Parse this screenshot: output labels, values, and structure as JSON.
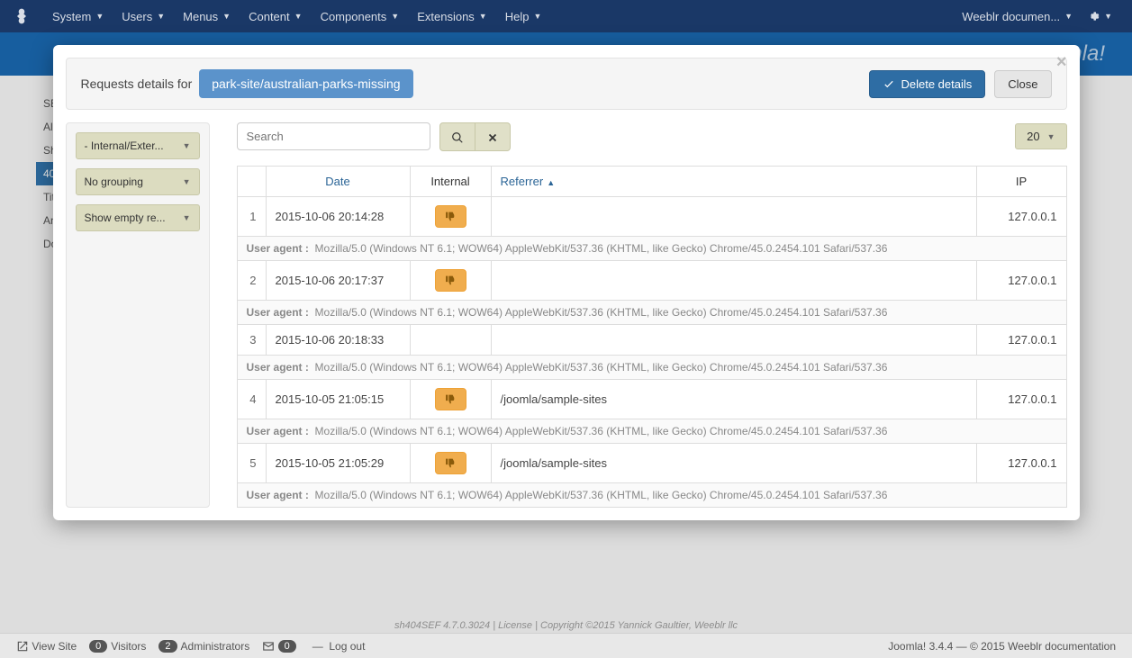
{
  "navbar": {
    "items": [
      "System",
      "Users",
      "Menus",
      "Content",
      "Components",
      "Extensions",
      "Help"
    ],
    "right_label": "Weeblr documen..."
  },
  "brand": "Joomla!",
  "modal": {
    "title_prefix": "Requests details for",
    "url_badge": "park-site/australian-parks-missing",
    "delete_btn": "Delete details",
    "close_btn": "Close",
    "search_placeholder": "Search",
    "page_size": "20"
  },
  "filters": {
    "f1": "- Internal/Exter...",
    "f2": "No grouping",
    "f3": "Show empty re..."
  },
  "columns": {
    "date": "Date",
    "internal": "Internal",
    "referrer": "Referrer",
    "ip": "IP"
  },
  "ua_label": "User agent :",
  "rows": [
    {
      "idx": "1",
      "date": "2015-10-06 20:14:28",
      "thumbs": true,
      "referrer": "",
      "ip": "127.0.0.1",
      "ua": "Mozilla/5.0 (Windows NT 6.1; WOW64) AppleWebKit/537.36 (KHTML, like Gecko) Chrome/45.0.2454.101 Safari/537.36"
    },
    {
      "idx": "2",
      "date": "2015-10-06 20:17:37",
      "thumbs": true,
      "referrer": "",
      "ip": "127.0.0.1",
      "ua": "Mozilla/5.0 (Windows NT 6.1; WOW64) AppleWebKit/537.36 (KHTML, like Gecko) Chrome/45.0.2454.101 Safari/537.36"
    },
    {
      "idx": "3",
      "date": "2015-10-06 20:18:33",
      "thumbs": false,
      "referrer": "",
      "ip": "127.0.0.1",
      "ua": "Mozilla/5.0 (Windows NT 6.1; WOW64) AppleWebKit/537.36 (KHTML, like Gecko) Chrome/45.0.2454.101 Safari/537.36"
    },
    {
      "idx": "4",
      "date": "2015-10-05 21:05:15",
      "thumbs": true,
      "referrer": "/joomla/sample-sites",
      "ip": "127.0.0.1",
      "ua": "Mozilla/5.0 (Windows NT 6.1; WOW64) AppleWebKit/537.36 (KHTML, like Gecko) Chrome/45.0.2454.101 Safari/537.36"
    },
    {
      "idx": "5",
      "date": "2015-10-05 21:05:29",
      "thumbs": true,
      "referrer": "/joomla/sample-sites",
      "ip": "127.0.0.1",
      "ua": "Mozilla/5.0 (Windows NT 6.1; WOW64) AppleWebKit/537.36 (KHTML, like Gecko) Chrome/45.0.2454.101 Safari/537.36"
    }
  ],
  "backdrop_tabs": [
    "SE",
    "Ali",
    "Sh",
    "40",
    "Tit",
    "An",
    "Do"
  ],
  "backdrop_active_tab": "40",
  "footer_line": "sh404SEF 4.7.0.3024 | License | Copyright ©2015 Yannick Gaultier, Weeblr llc",
  "status": {
    "view_site": "View Site",
    "visitors_count": "0",
    "visitors": "Visitors",
    "admins_count": "2",
    "admins": "Administrators",
    "msg_count": "0",
    "logout": "Log out",
    "right": "Joomla! 3.4.4  —  © 2015 Weeblr documentation"
  }
}
